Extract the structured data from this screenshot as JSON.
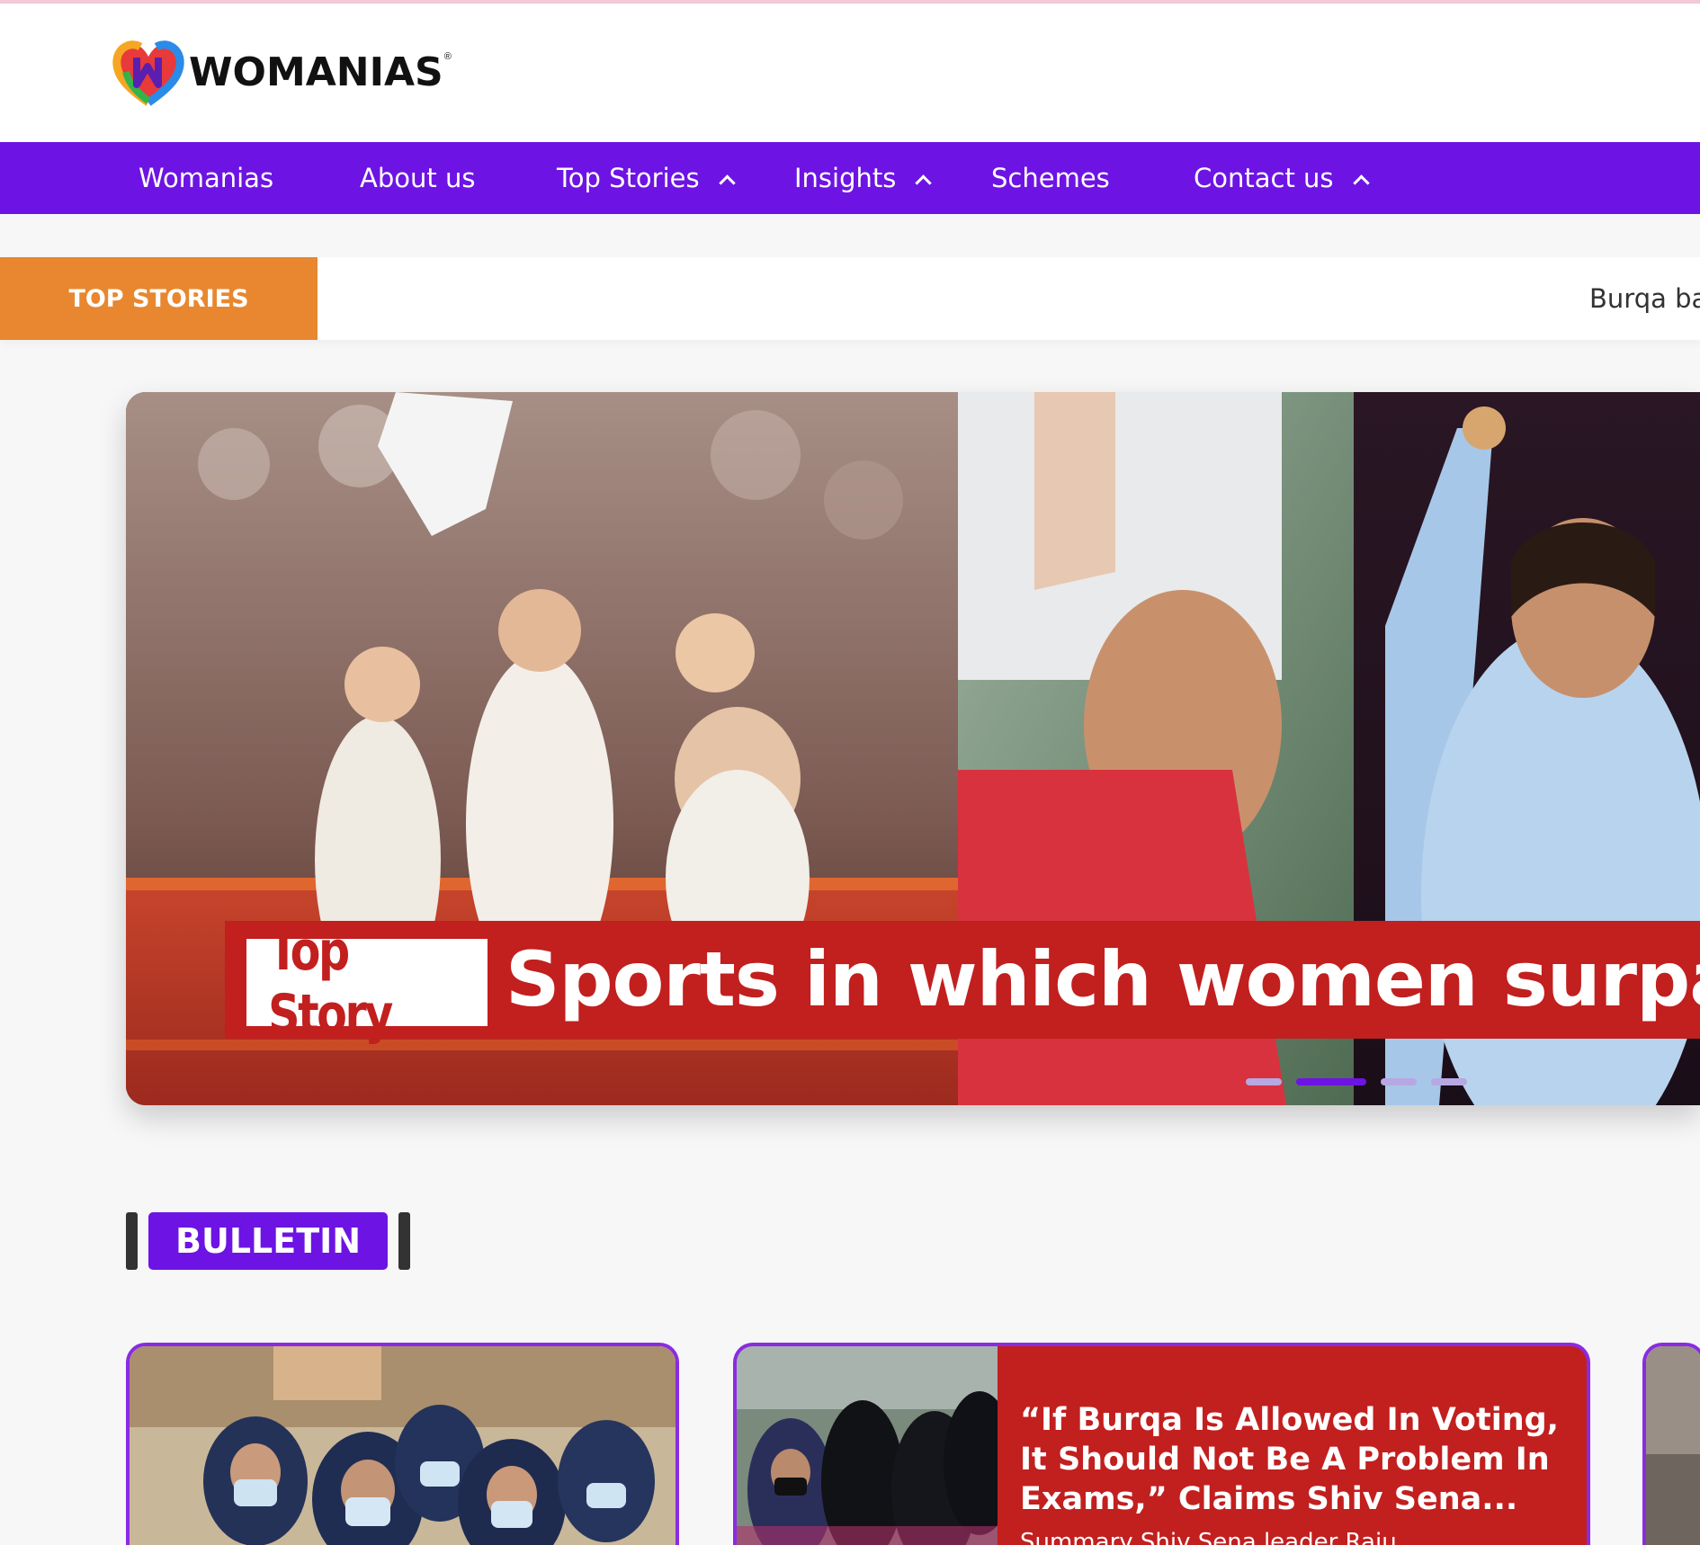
{
  "brand": {
    "name": "WOMANIAS",
    "reg": "®"
  },
  "nav": {
    "items": [
      {
        "label": "Womanias",
        "has_dropdown": false
      },
      {
        "label": "About us",
        "has_dropdown": false
      },
      {
        "label": "Top Stories",
        "has_dropdown": true
      },
      {
        "label": "Insights",
        "has_dropdown": true
      },
      {
        "label": "Schemes",
        "has_dropdown": false
      },
      {
        "label": "Contact us",
        "has_dropdown": true
      }
    ]
  },
  "ticker": {
    "label": "TOP STORIES",
    "text": "Burqa ba"
  },
  "hero": {
    "badge": "Top Story",
    "title": "Sports in which women surpas",
    "slides_total": 4,
    "active_slide": 1
  },
  "bulletin": {
    "heading": "BULLETIN",
    "cards": [
      {
        "title": "",
        "summary": ""
      },
      {
        "title": "“If Burqa Is Allowed In Voting, It Should Not Be A Problem In Exams,” Claims Shiv Sena...",
        "summary": "Summary Shiv Sena leader Raju"
      },
      {
        "title": "",
        "summary": ""
      }
    ]
  },
  "colors": {
    "nav": "#6d14e4",
    "ticker_label": "#e8872f",
    "banner": "#c21f1f",
    "card_border": "#8a2be2"
  }
}
